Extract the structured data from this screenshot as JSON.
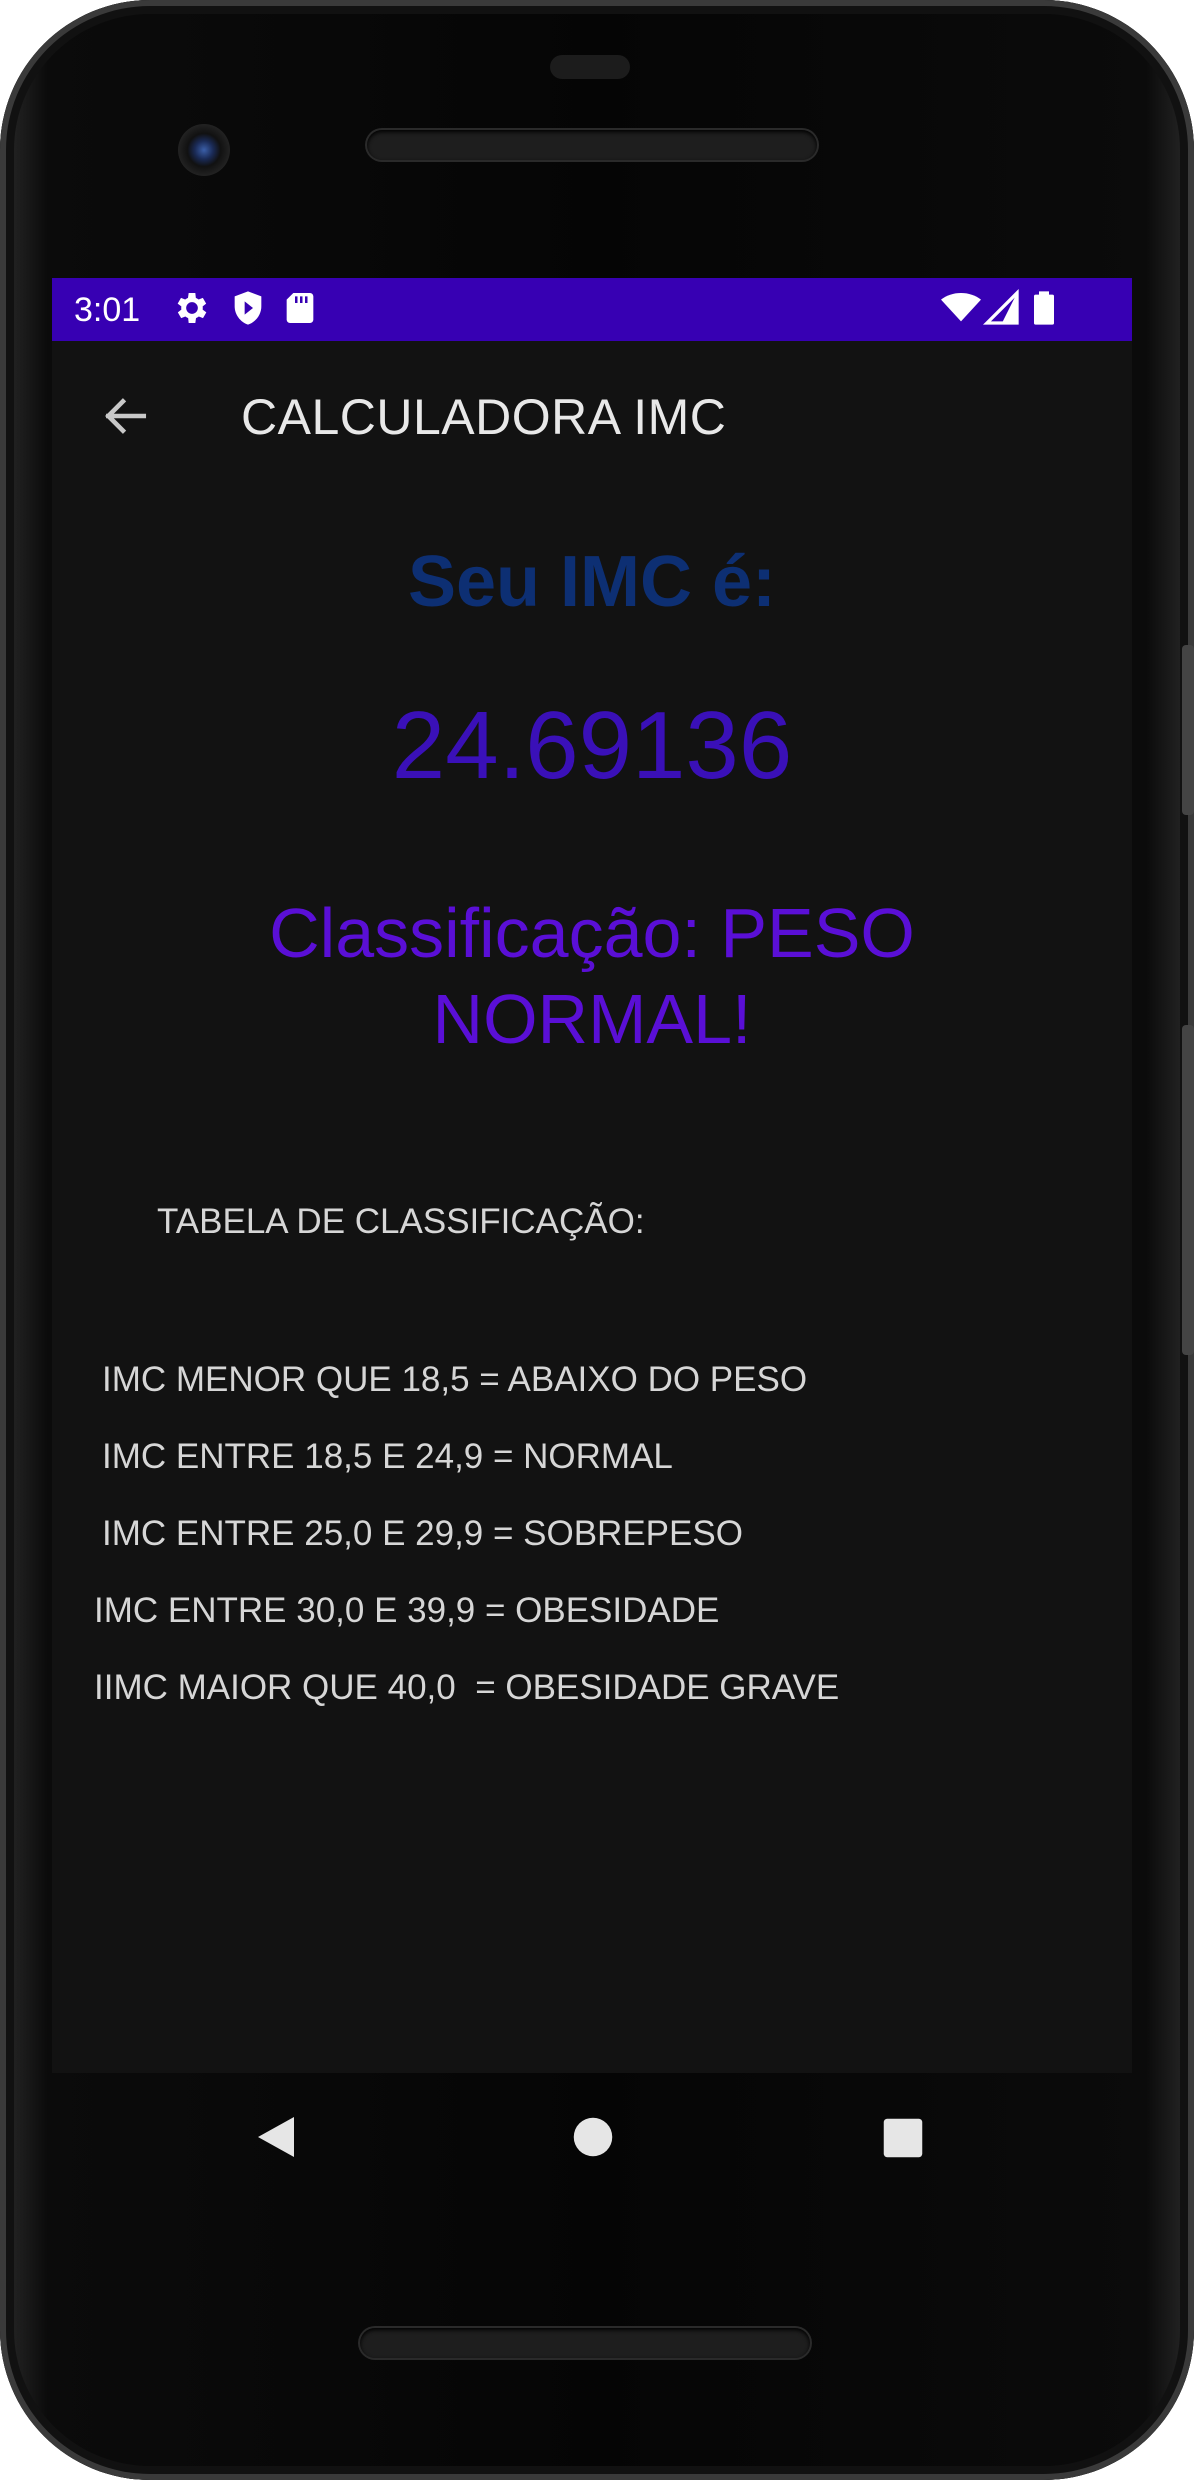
{
  "status_bar": {
    "time": "3:01",
    "left_icons": [
      "gear-icon",
      "shield-play-icon",
      "sd-card-icon"
    ],
    "right_icons": [
      "wifi-icon",
      "signal-icon",
      "battery-icon"
    ],
    "color": "#3700b3"
  },
  "app_bar": {
    "title": "CALCULADORA IMC",
    "back_icon": "back-arrow-icon"
  },
  "result": {
    "heading": "Seu IMC é:",
    "value": "24.69136",
    "classification": "Classificação: PESO NORMAL!"
  },
  "table": {
    "title": "TABELA DE CLASSIFICAÇÃO:",
    "rows": [
      "IMC MENOR QUE 18,5 = ABAIXO DO PESO",
      "IMC ENTRE 18,5 E 24,9 = NORMAL",
      "IMC ENTRE 25,0 E 29,9 = SOBREPESO",
      "IMC ENTRE 30,0 E 39,9 = OBESIDADE",
      "IIMC MAIOR QUE 40,0  = OBESIDADE GRAVE"
    ]
  },
  "nav_bar": {
    "icons": [
      "back-triangle-icon",
      "home-circle-icon",
      "recents-square-icon"
    ]
  },
  "colors": {
    "heading": "#0d2f73",
    "value": "#3a10b8",
    "classification": "#5a0fd6",
    "screen_bg": "#121212"
  }
}
